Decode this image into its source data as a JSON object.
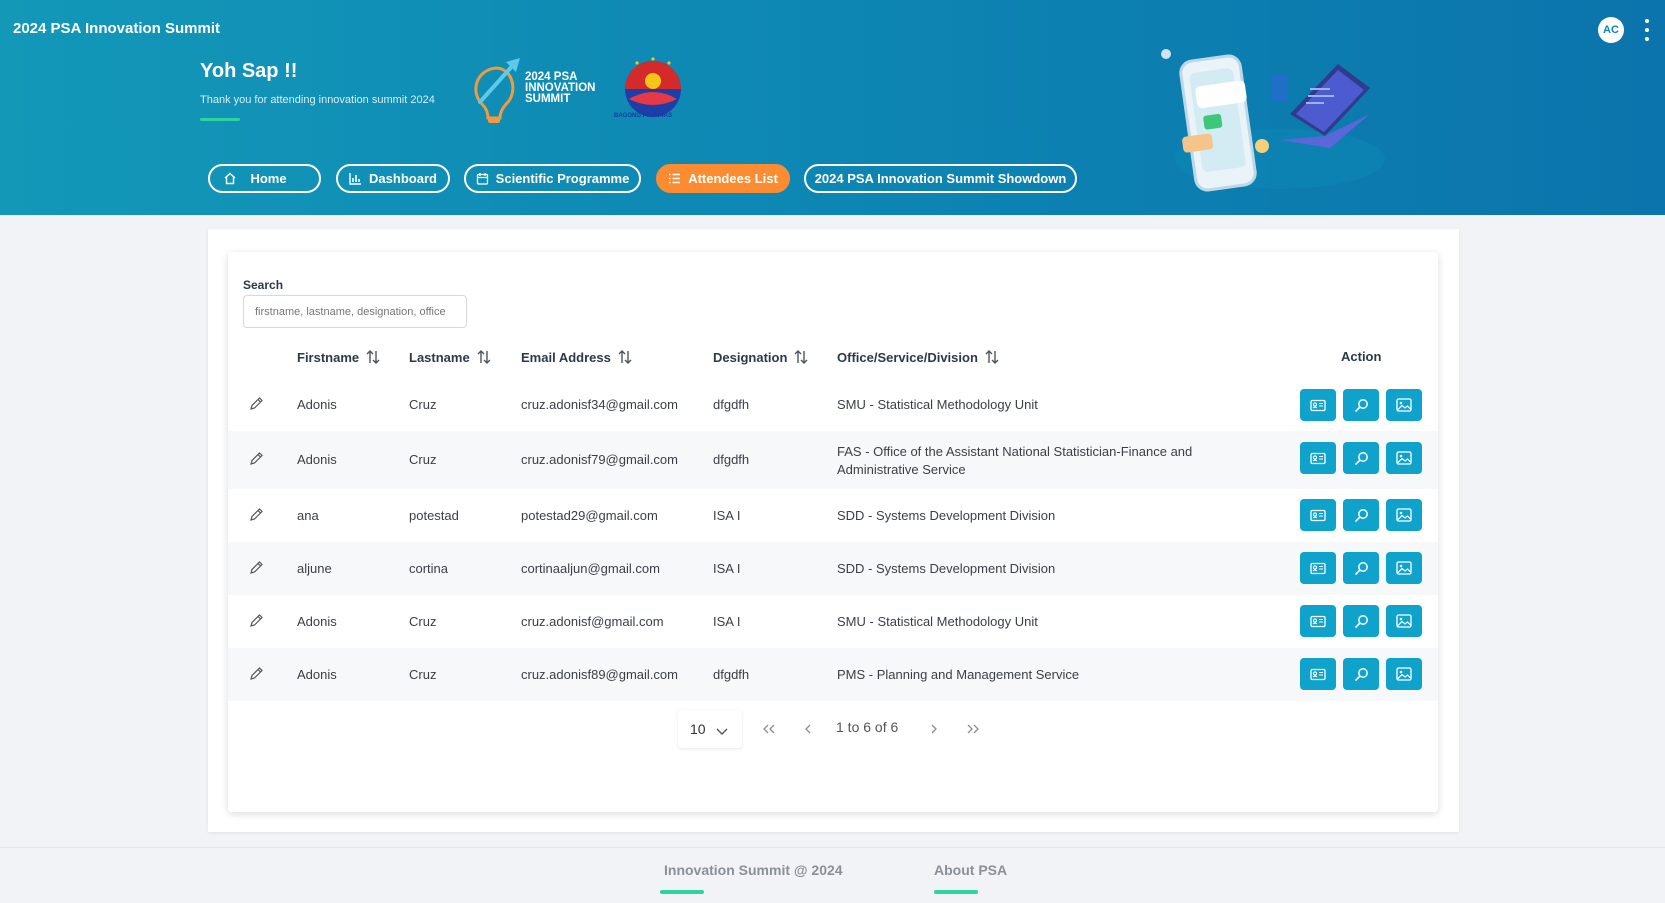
{
  "app": {
    "title": "2024 PSA Innovation Summit",
    "avatar_initials": "AC"
  },
  "hero": {
    "greeting": "Yoh Sap !!",
    "subtitle": "Thank you for attending innovation summit 2024",
    "summit_logo_text": [
      "2024 PSA",
      "INNOVATION",
      "SUMMIT"
    ],
    "bagong_logo_text": "BAGONG PILIPINAS"
  },
  "nav": [
    {
      "label": "Home",
      "icon": "home-icon",
      "active": false
    },
    {
      "label": "Dashboard",
      "icon": "bar-chart-icon",
      "active": false
    },
    {
      "label": "Scientific Programme",
      "icon": "calendar-icon",
      "active": false
    },
    {
      "label": "Attendees List",
      "icon": "list-icon",
      "active": true
    },
    {
      "label": "2024 PSA Innovation Summit Showdown",
      "icon": null,
      "active": false
    }
  ],
  "search": {
    "label": "Search",
    "placeholder": "firstname, lastname, designation, office",
    "value": ""
  },
  "table": {
    "columns": [
      "Firstname",
      "Lastname",
      "Email Address",
      "Designation",
      "Office/Service/Division",
      "Action"
    ],
    "rows": [
      {
        "firstname": "Adonis",
        "lastname": "Cruz",
        "email": "cruz.adonisf34@gmail.com",
        "designation": "dfgdfh",
        "office": "SMU - Statistical Methodology Unit"
      },
      {
        "firstname": "Adonis",
        "lastname": "Cruz",
        "email": "cruz.adonisf79@gmail.com",
        "designation": "dfgdfh",
        "office": "FAS - Office of the Assistant National Statistician-Finance and Administrative Service"
      },
      {
        "firstname": "ana",
        "lastname": "potestad",
        "email": "potestad29@gmail.com",
        "designation": "ISA I",
        "office": "SDD - Systems Development Division"
      },
      {
        "firstname": "aljune",
        "lastname": "cortina",
        "email": "cortinaaljun@gmail.com",
        "designation": "ISA I",
        "office": "SDD - Systems Development Division"
      },
      {
        "firstname": "Adonis",
        "lastname": "Cruz",
        "email": "cruz.adonisf@gmail.com",
        "designation": "ISA I",
        "office": "SMU - Statistical Methodology Unit"
      },
      {
        "firstname": "Adonis",
        "lastname": "Cruz",
        "email": "cruz.adonisf89@gmail.com",
        "designation": "dfgdfh",
        "office": "PMS - Planning and Management Service"
      }
    ],
    "action_icons": [
      "id-card-icon",
      "search-icon",
      "image-icon"
    ]
  },
  "pagination": {
    "page_size": "10",
    "range_text": "1 to 6 of 6"
  },
  "footer": {
    "links": [
      "Innovation Summit @ 2024",
      "About PSA"
    ]
  },
  "colors": {
    "header_start": "#1398b8",
    "header_end": "#0b74ac",
    "accent_orange": "#fb8c32",
    "action_blue": "#0fa3cb",
    "green_bar": "#2dd4a0"
  }
}
